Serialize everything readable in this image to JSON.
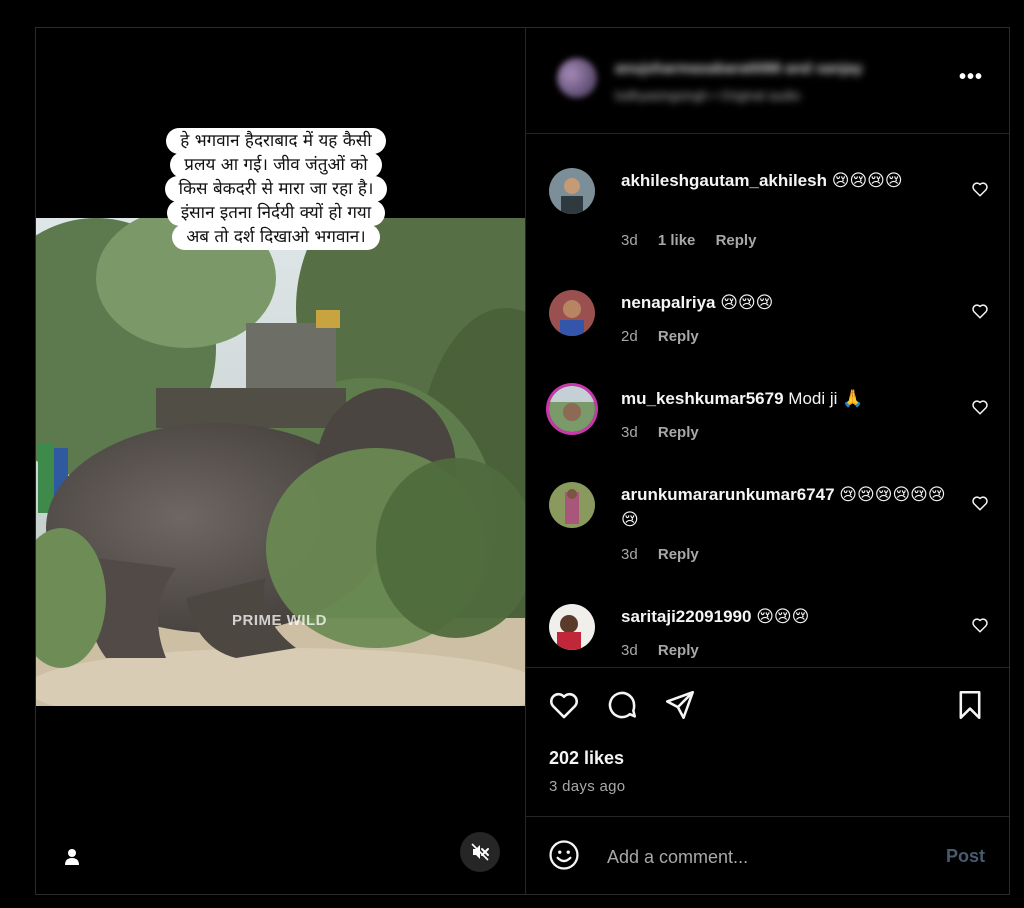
{
  "header": {
    "username": "anujsharmasabara0088 and sanjay",
    "subline": "lodhyasingsingh • Original audio",
    "more_label": "•••"
  },
  "media": {
    "caption_lines": [
      "हे भगवान हैदराबाद में यह कैसी",
      "प्रलय आ गई। जीव जंतुओं को",
      "किस बेकदरी से मारा जा रहा है।",
      "इंसान इतना निर्दयी क्यों हो गया",
      "अब तो दर्श दिखाओ भगवान।"
    ],
    "watermark": "PRIME WILD",
    "user_tag_icon": "person-icon",
    "mute_icon": "speaker-muted-icon"
  },
  "comments": [
    {
      "user": "akhileshgautam_akhilesh",
      "text": "😢😢😢😢",
      "age": "3d",
      "likes": "1 like",
      "reply": "Reply"
    },
    {
      "user": "nenapalriya",
      "text": "😢😢😢",
      "age": "2d",
      "likes": "",
      "reply": "Reply"
    },
    {
      "user": "mu_keshkumar5679",
      "text": "Modi ji 🙏",
      "age": "3d",
      "likes": "",
      "reply": "Reply"
    },
    {
      "user": "arunkumararunkumar6747",
      "text": "😢😢😢😢😢😢😢",
      "age": "3d",
      "likes": "",
      "reply": "Reply"
    },
    {
      "user": "saritaji22091990",
      "text": "😢😢😢",
      "age": "3d",
      "likes": "",
      "reply": "Reply"
    }
  ],
  "actions": {
    "like_icon": "heart-icon",
    "comment_icon": "comment-bubble-icon",
    "share_icon": "paper-plane-icon",
    "save_icon": "bookmark-icon"
  },
  "likes_count": "202 likes",
  "time_ago": "3 days ago",
  "composer": {
    "placeholder": "Add a comment...",
    "post_label": "Post",
    "emoji_icon": "smiley-icon"
  },
  "colors": {
    "background": "#000000",
    "border": "#262626",
    "muted_text": "#a8a8a8",
    "post_disabled": "#4a5a70",
    "story_ring": "#c837ab"
  }
}
